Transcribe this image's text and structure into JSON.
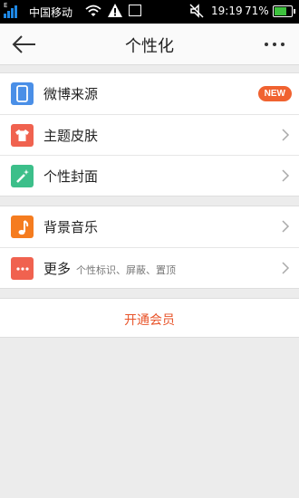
{
  "status_bar": {
    "network_label": "E",
    "carrier": "中国移动",
    "time": "19:19",
    "battery_percent": "71%",
    "battery_level": 0.71
  },
  "header": {
    "title": "个性化",
    "back_icon": "back-arrow-icon",
    "more_icon": "more-icon"
  },
  "sections": [
    {
      "items": [
        {
          "label": "微博来源",
          "icon": "phone-icon",
          "color": "#4a8fe7",
          "badge": "NEW"
        },
        {
          "label": "主题皮肤",
          "icon": "shirt-icon",
          "color": "#f0624f"
        },
        {
          "label": "个性封面",
          "icon": "magic-wand-icon",
          "color": "#3cbf8a"
        }
      ]
    },
    {
      "items": [
        {
          "label": "背景音乐",
          "icon": "music-note-icon",
          "color": "#f57c1f"
        },
        {
          "label": "更多",
          "sublabel": "个性标识、屏蔽、置顶",
          "icon": "more-dots-icon",
          "color": "#f0624f"
        }
      ]
    }
  ],
  "vip_button": {
    "label": "开通会员",
    "color": "#e8542a"
  }
}
